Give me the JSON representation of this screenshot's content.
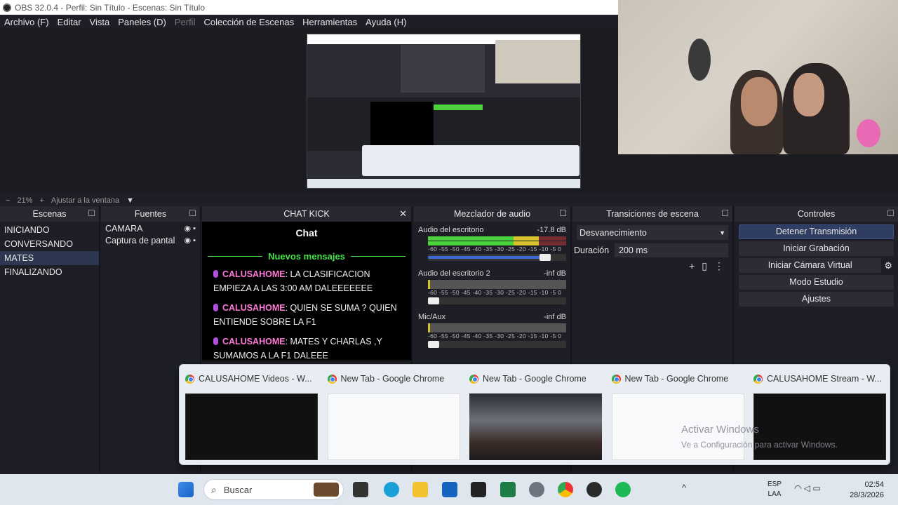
{
  "window": {
    "title": "OBS 32.0.4 - Perfil: Sin Título - Escenas: Sin Título"
  },
  "menu": [
    "Archivo (F)",
    "Editar",
    "Vista",
    "Paneles (D)",
    "Perfil",
    "Colección de Escenas",
    "Herramientas",
    "Ayuda (H)"
  ],
  "zoom": {
    "percent": "21%",
    "fit_label": "Ajustar a la ventana"
  },
  "docks": {
    "scenes_title": "Escenas",
    "sources_title": "Fuentes",
    "chat_title": "CHAT KICK",
    "mixer_title": "Mezclador de audio",
    "transitions_title": "Transiciones de escena",
    "controls_title": "Controles"
  },
  "scenes": [
    "INICIANDO",
    "CONVERSANDO",
    "MATES",
    "FINALIZANDO"
  ],
  "selected_scene": "MATES",
  "sources": [
    "CAMARA",
    "Captura de pantal"
  ],
  "chat": {
    "header": "Chat",
    "banner": "Nuevos mensajes",
    "messages": [
      {
        "user": "CALUSAHOME",
        "text": "LA CLASIFICACION EMPIEZA A LAS 3:00 AM DALEEEEEEE"
      },
      {
        "user": "CALUSAHOME",
        "text": "QUIEN SE SUMA ? QUIEN ENTIENDE SOBRE LA F1"
      },
      {
        "user": "CALUSAHOME",
        "text": "MATES Y CHARLAS ,Y SUMAMOS A LA F1 DALEEE"
      }
    ]
  },
  "mixer": {
    "channels": [
      {
        "name": "Audio del escritorio",
        "level": "-17.8 dB",
        "volume": 0.85,
        "active": true
      },
      {
        "name": "Audio del escritorio 2",
        "level": "-inf dB",
        "volume": 0.05,
        "active": false
      },
      {
        "name": "Mic/Aux",
        "level": "-inf dB",
        "volume": 0.05,
        "active": false
      }
    ],
    "ticks": "-60 -55 -50 -45 -40 -35 -30 -25 -20 -15 -10 -5 0"
  },
  "transitions": {
    "type": "Desvanecimiento",
    "duration_label": "Duración",
    "duration_value": "200 ms"
  },
  "controls": [
    "Detener Transmisión",
    "Iniciar Grabación",
    "Iniciar Cámara Virtual",
    "Modo Estudio",
    "Ajustes"
  ],
  "switcher": [
    {
      "title": "CALUSAHOME Videos - W...",
      "style": "dark"
    },
    {
      "title": "New Tab - Google Chrome",
      "style": "white"
    },
    {
      "title": "New Tab - Google Chrome",
      "style": "photo"
    },
    {
      "title": "New Tab - Google Chrome",
      "style": "white"
    },
    {
      "title": "CALUSAHOME Stream - W...",
      "style": "dark"
    }
  ],
  "watermark": {
    "line1": "Activar Windows",
    "line2": "Ve a Configuración para activar Windows."
  },
  "taskbar": {
    "search_placeholder": "Buscar",
    "lang1": "ESP",
    "lang2": "LAA",
    "time": "02:54",
    "date": "28/3/2026"
  },
  "colors": {
    "accent": "#2f3d62",
    "meter_green": "#4cd23a",
    "meter_yellow": "#d6c22b",
    "meter_red": "#c83a3a",
    "chat_user": "#ff7ad6",
    "chat_banner": "#46e04a"
  }
}
